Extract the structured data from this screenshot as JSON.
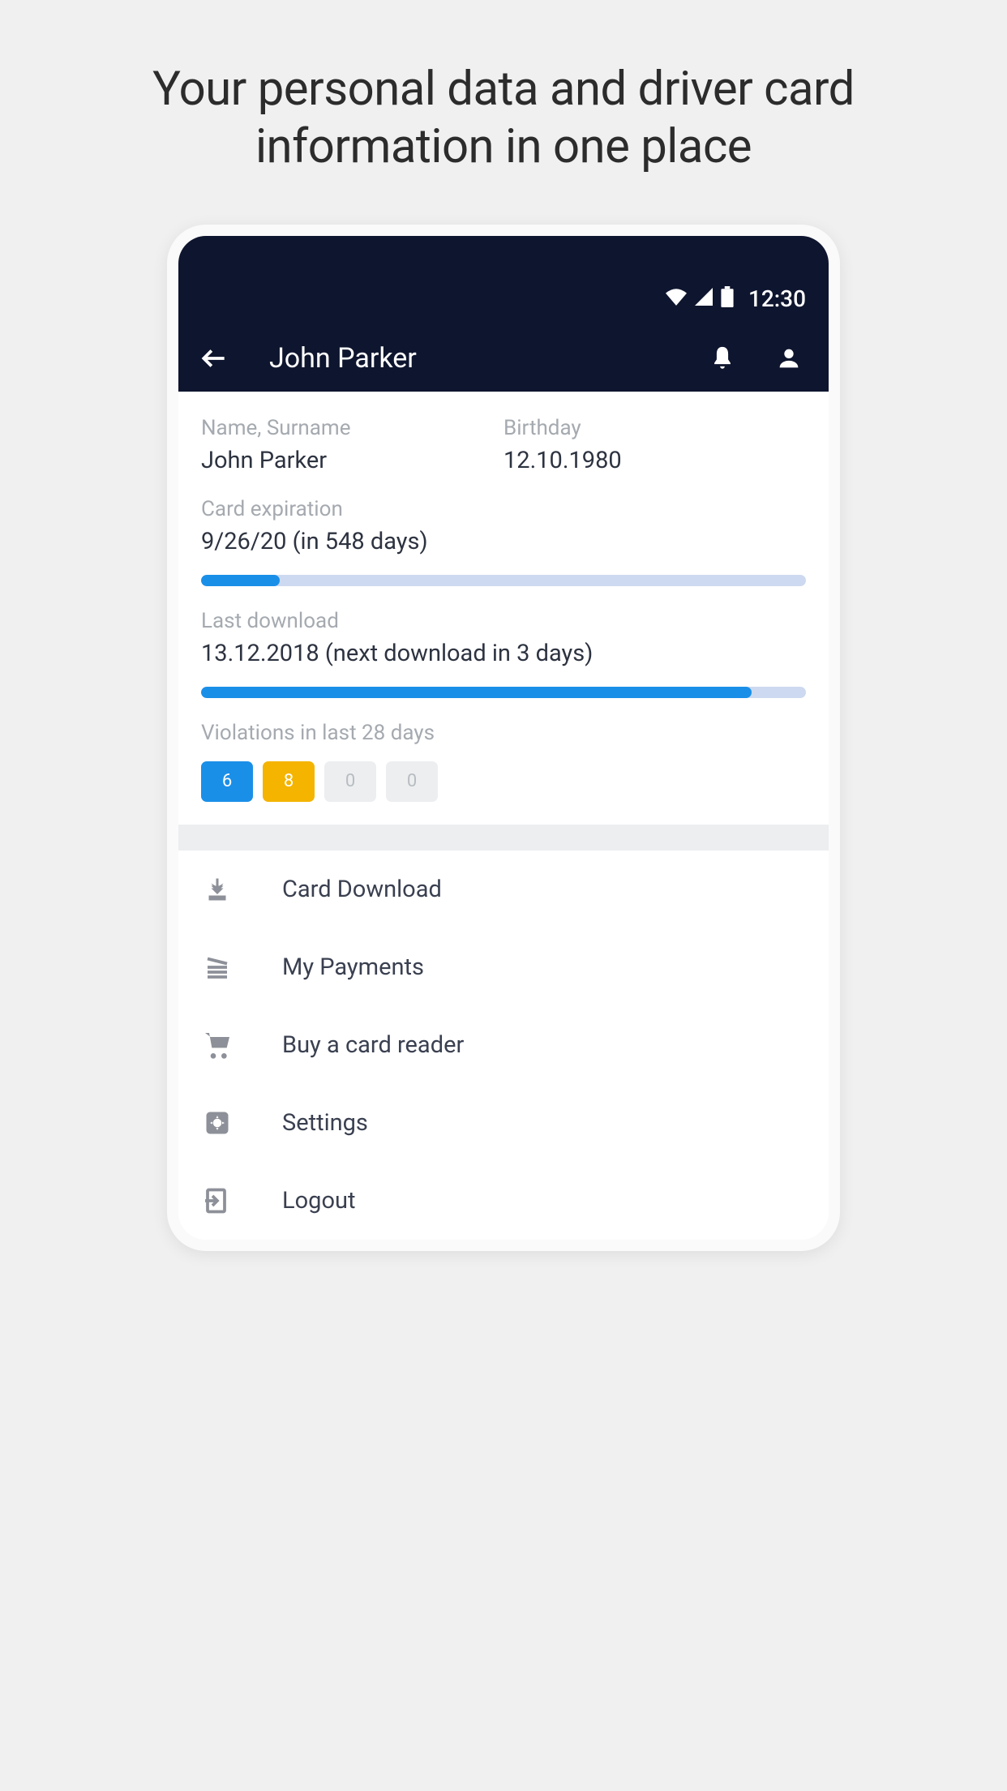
{
  "headline": "Your personal data and driver card information in one place",
  "status": {
    "time": "12:30"
  },
  "appbar": {
    "title": "John Parker"
  },
  "profile": {
    "name_label": "Name, Surname",
    "name_value": "John Parker",
    "birthday_label": "Birthday",
    "birthday_value": "12.10.1980",
    "expiration_label": "Card expiration",
    "expiration_value": "9/26/20 (in 548 days)",
    "expiration_progress_percent": 13,
    "download_label": "Last download",
    "download_value": "13.12.2018 (next download in 3 days)",
    "download_progress_percent": 91,
    "violations_label": "Violations in last 28 days",
    "violations": [
      {
        "value": "6",
        "style": "blue"
      },
      {
        "value": "8",
        "style": "yellow"
      },
      {
        "value": "0",
        "style": "gray"
      },
      {
        "value": "0",
        "style": "gray"
      }
    ]
  },
  "menu": {
    "items": [
      {
        "label": "Card Download",
        "icon": "download-icon"
      },
      {
        "label": "My Payments",
        "icon": "reader-icon"
      },
      {
        "label": "Buy a card reader",
        "icon": "cart-icon"
      },
      {
        "label": "Settings",
        "icon": "settings-icon"
      },
      {
        "label": "Logout",
        "icon": "logout-icon"
      }
    ]
  }
}
